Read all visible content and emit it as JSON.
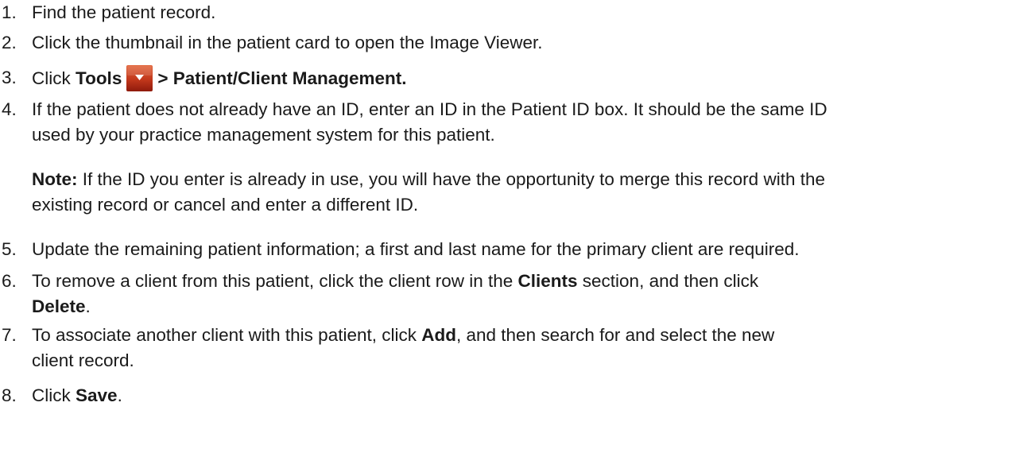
{
  "steps": [
    {
      "number": "1.",
      "text": "Find the patient record."
    },
    {
      "number": "2.",
      "text": "Click the thumbnail in the patient card to open the Image Viewer."
    },
    {
      "number": "3.",
      "click": "Click ",
      "tools": "Tools",
      "arrow": ">",
      "target": "Patient/Client Management."
    },
    {
      "number": "4.",
      "line1": "If the patient does not already have an ID, enter an ID in the Patient ID box. It should be the same ID",
      "line2": "used by your practice management system for this patient."
    },
    {
      "number": "5.",
      "text": "Update the remaining patient information; a first and last name for the primary client are required."
    },
    {
      "number": "6.",
      "pre": "To remove a client from this patient, click the client row in the ",
      "clients": "Clients",
      "post": " section, and then click",
      "delete": "Delete",
      "end": "."
    },
    {
      "number": "7.",
      "pre": "To associate another client with this patient, click ",
      "add": "Add",
      "post": ", and then search for and select the new",
      "line2": "client record."
    },
    {
      "number": "8.",
      "pre": "Click ",
      "save": "Save",
      "end": "."
    }
  ],
  "note": {
    "label": "Note:",
    "line1": " If the ID you enter is already in use, you will have the opportunity to merge this record with the",
    "line2": "existing record or cancel and enter a different ID."
  },
  "icons": {
    "tools_dropdown": "chevron-down-icon",
    "tools_color_top": "#d9532b",
    "tools_color_bottom": "#9e1f0f"
  }
}
